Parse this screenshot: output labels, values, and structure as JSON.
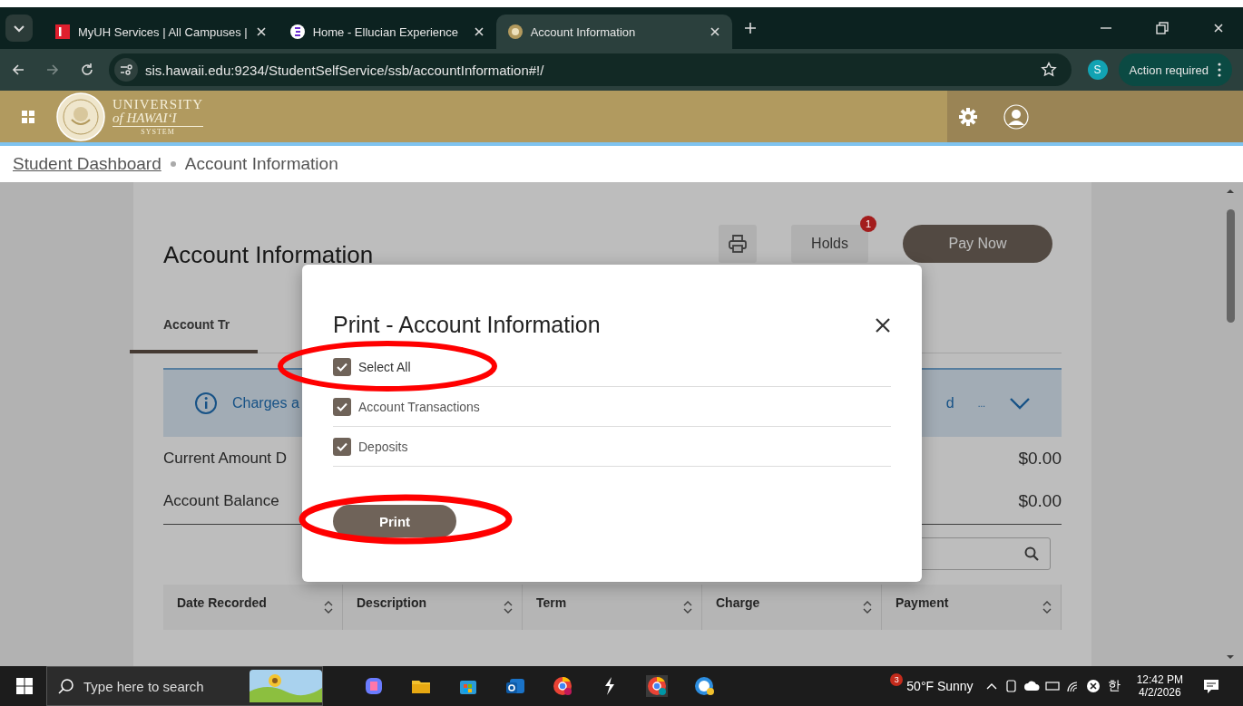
{
  "browser": {
    "tabs": [
      {
        "title": "MyUH Services | All Campuses |",
        "selected": false,
        "kind": "myuh"
      },
      {
        "title": "Home - Ellucian Experience",
        "selected": false,
        "kind": "ellucian"
      },
      {
        "title": "Account Information",
        "selected": true,
        "kind": "uh"
      }
    ],
    "url": "sis.hawaii.edu:9234/StudentSelfService/ssb/accountInformation#!/",
    "profile_initial": "S",
    "action": "Action required"
  },
  "header": {
    "logo_lines": [
      "UNIVERSITY",
      "of HAWAIʻI",
      "SYSTEM"
    ]
  },
  "breadcrumb": [
    "Student Dashboard",
    "Account Information"
  ],
  "page": {
    "title": "Account Information",
    "holds_label": "Holds",
    "holds_count": "1",
    "pay_button": "Pay Now",
    "tab_label": "Account Tr",
    "info_text": "Charges a",
    "info_right": "d",
    "info_more": "...",
    "rows": [
      {
        "label": "Current Amount D",
        "value": "$0.00"
      },
      {
        "label": "Account Balance",
        "value": "$0.00"
      }
    ],
    "columns": [
      "Date Recorded",
      "Description",
      "Term",
      "Charge",
      "Payment"
    ]
  },
  "dialog": {
    "title": "Print - Account Information",
    "items": [
      {
        "label": "Select All",
        "checked": true,
        "highlighted": true
      },
      {
        "label": "Account Transactions",
        "checked": true,
        "highlighted": false
      },
      {
        "label": "Deposits",
        "checked": true,
        "highlighted": false
      }
    ],
    "print_button": {
      "label": "Print",
      "highlighted": true
    }
  },
  "taskbar": {
    "search_placeholder": "Type here to search",
    "weather_badge": "3",
    "weather": "50°F  Sunny",
    "ime": "한",
    "time": "12:42 PM",
    "date": "4/2/2026"
  }
}
